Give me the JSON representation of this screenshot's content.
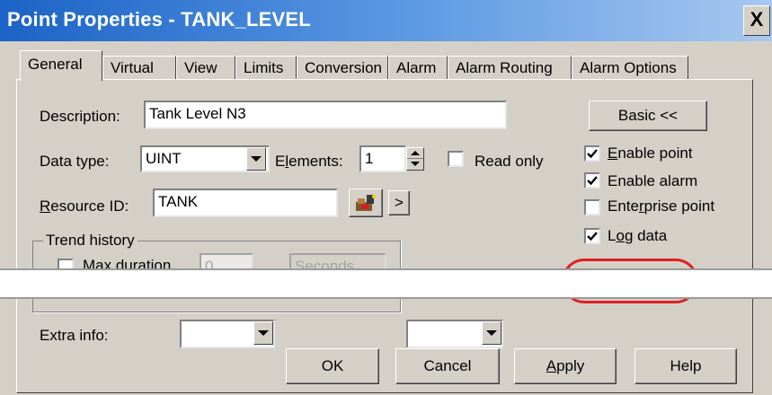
{
  "window": {
    "title": "Point Properties - TANK_LEVEL",
    "close_glyph": "X"
  },
  "tabs": [
    {
      "label": "General",
      "active": true
    },
    {
      "label": "Virtual"
    },
    {
      "label": "View"
    },
    {
      "label": "Limits"
    },
    {
      "label": "Conversion"
    },
    {
      "label": "Alarm"
    },
    {
      "label": "Alarm Routing"
    },
    {
      "label": "Alarm Options"
    }
  ],
  "general": {
    "description_label": "Description:",
    "description_value": "Tank Level N3",
    "data_type_label": "Data type:",
    "data_type_value": "UINT",
    "elements_label": "Elements:",
    "elements_value": "1",
    "read_only_label": "Read only",
    "resource_id_label": "Resource ID:",
    "resource_id_value": "TANK",
    "browse_glyph": ">",
    "basic_button": "Basic <<",
    "trend_history_label": "Trend history",
    "max_duration_label": "Max duration",
    "max_duration_value": "0",
    "duration_unit": "Seconds",
    "extra_info_label": "Extra info:",
    "enable_point_label": "Enable point",
    "enable_alarm_label": "Enable alarm",
    "enterprise_point_label": "Enterprise point",
    "log_data_label": "Log data",
    "checks": {
      "enable_point": true,
      "enable_alarm": true,
      "enterprise_point": false,
      "log_data": true,
      "read_only": false,
      "max_duration": false
    }
  },
  "buttons": {
    "ok": "OK",
    "cancel": "Cancel",
    "apply": "Apply",
    "help": "Help"
  },
  "colors": {
    "dialog": "#d4d0c8",
    "title_start": "#1b63c6",
    "highlight": "#e02020"
  }
}
